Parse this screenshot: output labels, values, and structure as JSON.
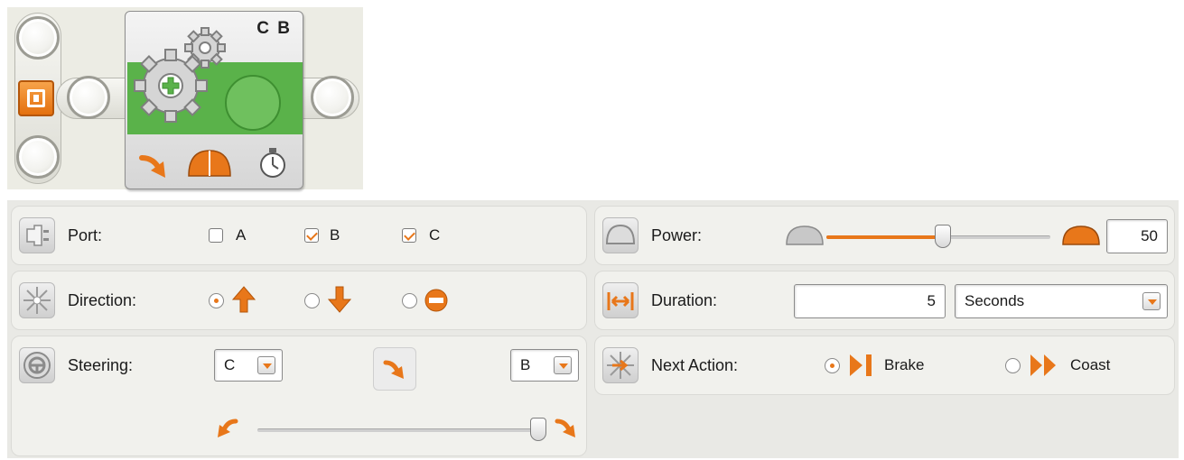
{
  "block": {
    "ports_label": "C B",
    "icons": [
      "gears-icon",
      "direction-arrow-icon",
      "power-icon",
      "timer-icon"
    ]
  },
  "port": {
    "label": "Port:",
    "options": [
      {
        "label": "A",
        "checked": false
      },
      {
        "label": "B",
        "checked": true
      },
      {
        "label": "C",
        "checked": true
      }
    ]
  },
  "direction": {
    "label": "Direction:",
    "options": [
      "forward",
      "backward",
      "stop"
    ],
    "selected": "forward"
  },
  "steering": {
    "label": "Steering:",
    "left_motor": "C",
    "right_motor": "B",
    "slider_value": 1.0
  },
  "power": {
    "label": "Power:",
    "value": "50"
  },
  "duration": {
    "label": "Duration:",
    "value": "5",
    "unit": "Seconds"
  },
  "next_action": {
    "label": "Next Action:",
    "options": [
      "Brake",
      "Coast"
    ],
    "selected": "Brake"
  },
  "colors": {
    "accent": "#e8771a",
    "block_green": "#5ab24a",
    "panel_bg": "#e9e9e5"
  }
}
